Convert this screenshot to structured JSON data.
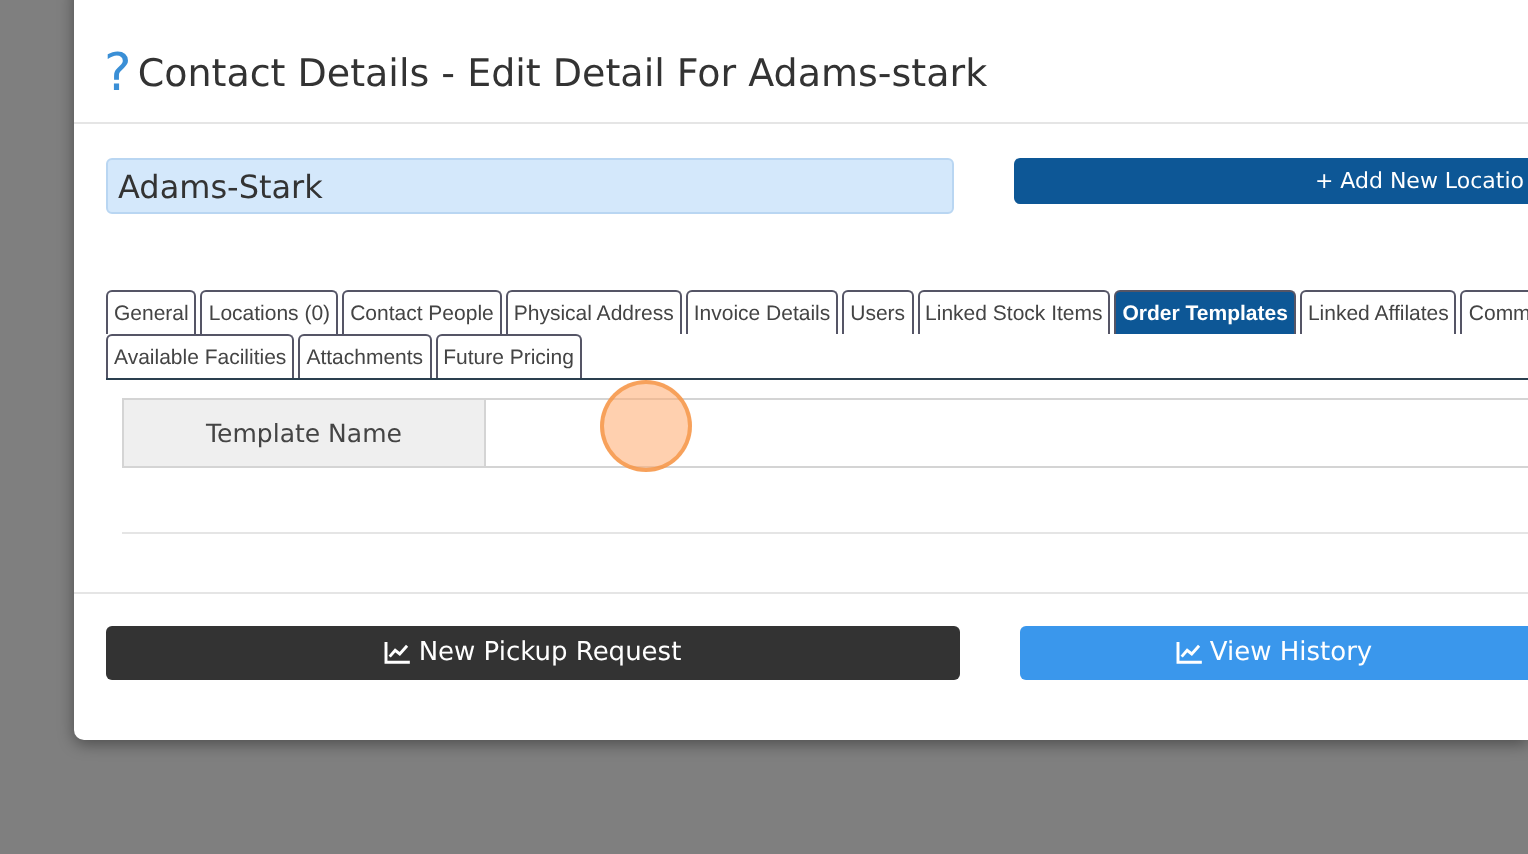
{
  "dialog": {
    "help_icon": "?",
    "title": "Contact Details - Edit Detail For Adams-stark"
  },
  "name_field": {
    "value": "Adams-Stark"
  },
  "add_button": {
    "icon": "+",
    "label": "Add New Locatio"
  },
  "tab_rows": [
    [
      {
        "label": "General",
        "selected": false
      },
      {
        "label": "Locations (0)",
        "selected": false
      },
      {
        "label": "Contact People",
        "selected": false
      },
      {
        "label": "Physical Address",
        "selected": false
      },
      {
        "label": "Invoice Details",
        "selected": false
      },
      {
        "label": "Users",
        "selected": false
      },
      {
        "label": "Linked Stock Items",
        "selected": false
      },
      {
        "label": "Order Templates",
        "selected": true
      },
      {
        "label": "Linked Affilates",
        "selected": false
      },
      {
        "label": "Comm",
        "selected": false
      }
    ],
    [
      {
        "label": "Available Facilities",
        "selected": false
      },
      {
        "label": "Attachments",
        "selected": false
      },
      {
        "label": "Future Pricing",
        "selected": false
      }
    ]
  ],
  "table": {
    "columns": [
      "Template Name"
    ]
  },
  "buttons": [
    {
      "label": "New Pickup Request",
      "kind": "dark"
    },
    {
      "label": "View History",
      "kind": "primary"
    }
  ]
}
